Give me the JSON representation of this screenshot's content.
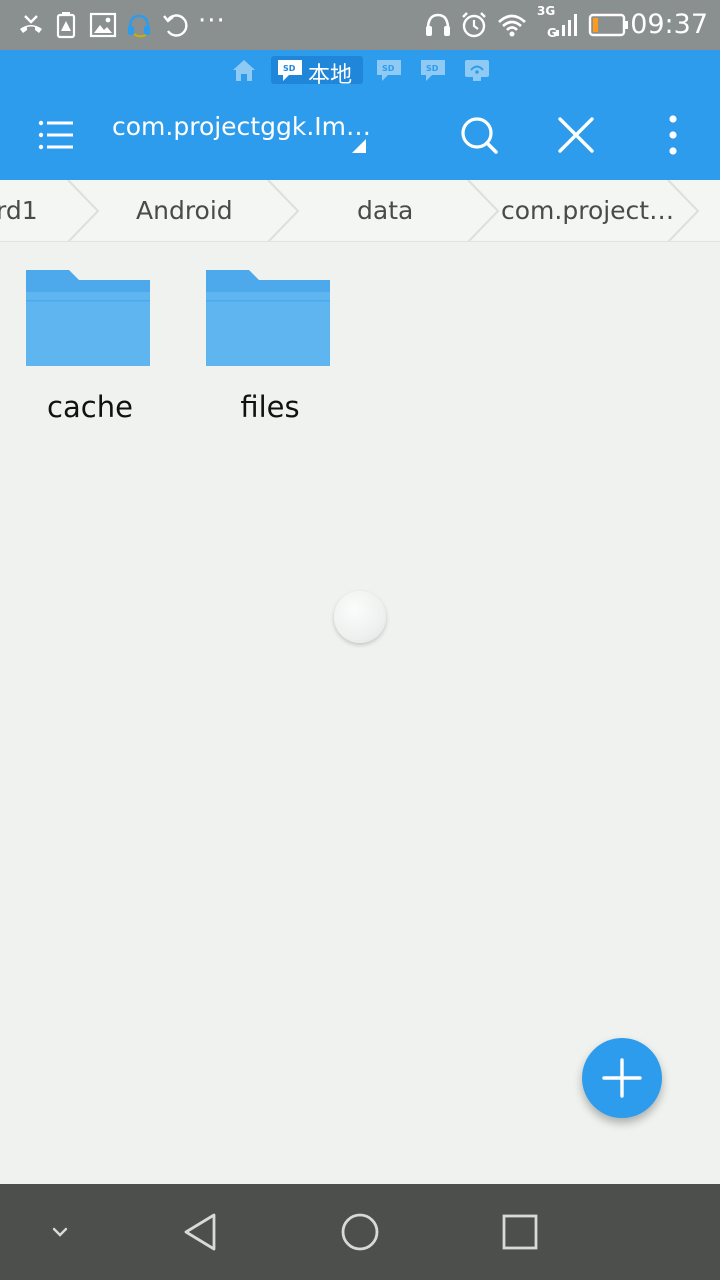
{
  "status_bar": {
    "time": "09:37",
    "network": "3G",
    "network_sub": "G",
    "overflow": "···",
    "icons": [
      "missed-call-icon",
      "battery-warning-icon",
      "image-icon",
      "headset-app-icon",
      "sync-icon",
      "headphones-icon",
      "alarm-icon",
      "wifi-icon",
      "signal-icon",
      "battery-low-icon"
    ]
  },
  "location_bar": {
    "active_label": "本地",
    "items": [
      "home-icon",
      "sd-card-icon",
      "network-icon",
      "network-icon",
      "remote-icon"
    ]
  },
  "toolbar": {
    "title": "com.projectggk.Im…",
    "icons": [
      "menu-icon",
      "search-icon",
      "close-icon",
      "more-vert-icon"
    ]
  },
  "breadcrumb": {
    "items": [
      "rd1",
      "Android",
      "data",
      "com.project…"
    ]
  },
  "files": [
    {
      "name": "cache",
      "type": "folder"
    },
    {
      "name": "files",
      "type": "folder"
    }
  ],
  "colors": {
    "accent": "#2e9cec",
    "status_bar": "#8a8f8f",
    "background": "#eff2ef",
    "folder": "#5fb5f0",
    "nav_bar": "#4d4f4c"
  },
  "nav_bar": {
    "icons": [
      "hide-keyboard-icon",
      "back-icon",
      "home-icon",
      "recents-icon"
    ]
  }
}
